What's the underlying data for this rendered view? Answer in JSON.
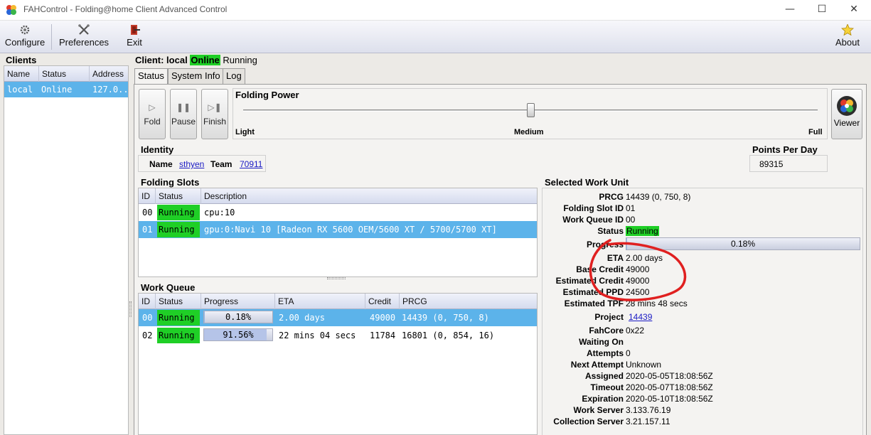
{
  "window": {
    "title": "FAHControl - Folding@home Client Advanced Control"
  },
  "toolbar": {
    "configure": "Configure",
    "preferences": "Preferences",
    "exit": "Exit",
    "about": "About"
  },
  "clients": {
    "title": "Clients",
    "columns": [
      "Name",
      "Status",
      "Address"
    ],
    "row": {
      "name": "local",
      "status": "Online",
      "address": "127.0.."
    }
  },
  "client_header": {
    "label": "Client: local",
    "online": "Online",
    "state": "Running"
  },
  "tabs": [
    "Status",
    "System Info",
    "Log"
  ],
  "controls": {
    "fold": "Fold",
    "pause": "Pause",
    "finish": "Finish",
    "viewer": "Viewer"
  },
  "folding_power": {
    "title": "Folding Power",
    "light": "Light",
    "medium": "Medium",
    "full": "Full",
    "level": 0.5
  },
  "identity": {
    "title": "Identity",
    "name_label": "Name",
    "name": "sthyen",
    "team_label": "Team",
    "team": "70911"
  },
  "ppd": {
    "title": "Points Per Day",
    "value": "89315"
  },
  "folding_slots": {
    "title": "Folding Slots",
    "columns": [
      "ID",
      "Status",
      "Description"
    ],
    "rows": [
      {
        "id": "00",
        "status": "Running",
        "description": "cpu:10"
      },
      {
        "id": "01",
        "status": "Running",
        "description": "gpu:0:Navi 10 [Radeon RX 5600 OEM/5600 XT / 5700/5700 XT]"
      }
    ]
  },
  "work_queue": {
    "title": "Work Queue",
    "columns": [
      "ID",
      "Status",
      "Progress",
      "ETA",
      "Credit",
      "PRCG"
    ],
    "rows": [
      {
        "id": "00",
        "status": "Running",
        "progress": "0.18%",
        "progress_value": 0.18,
        "eta": "2.00 days",
        "credit": "49000",
        "prcg": "14439 (0, 750, 8)"
      },
      {
        "id": "02",
        "status": "Running",
        "progress": "91.56%",
        "progress_value": 91.56,
        "eta": "22 mins 04 secs",
        "credit": "11784",
        "prcg": "16801 (0, 854, 16)"
      }
    ]
  },
  "selected_wu": {
    "title": "Selected Work Unit",
    "labels": {
      "prcg": "PRCG",
      "slot": "Folding Slot ID",
      "queue": "Work Queue ID",
      "status": "Status",
      "progress": "Progress",
      "eta": "ETA",
      "base_credit": "Base Credit",
      "est_credit": "Estimated Credit",
      "est_ppd": "Estimated PPD",
      "est_tpf": "Estimated TPF",
      "project": "Project",
      "fahcore": "FahCore",
      "waiting": "Waiting On",
      "attempts": "Attempts",
      "next_attempt": "Next Attempt",
      "assigned": "Assigned",
      "timeout": "Timeout",
      "expiration": "Expiration",
      "work_server": "Work Server",
      "collection_server": "Collection Server"
    },
    "values": {
      "prcg": "14439 (0, 750, 8)",
      "slot": "01",
      "queue": "00",
      "status": "Running",
      "progress": "0.18%",
      "progress_value": 0.18,
      "eta": "2.00 days",
      "base_credit": "49000",
      "est_credit": "49000",
      "est_ppd": "24500",
      "est_tpf": "28 mins 48 secs",
      "project": "14439",
      "fahcore": "0x22",
      "waiting": "",
      "attempts": "0",
      "next_attempt": "Unknown",
      "assigned": "2020-05-05T18:08:56Z",
      "timeout": "2020-05-07T18:08:56Z",
      "expiration": "2020-05-10T18:08:56Z",
      "work_server": "3.133.76.19",
      "collection_server": "3.21.157.11"
    }
  },
  "colors": {
    "running": "#1fcf26",
    "selection": "#5cb3ea",
    "annotation": "#e02020"
  }
}
